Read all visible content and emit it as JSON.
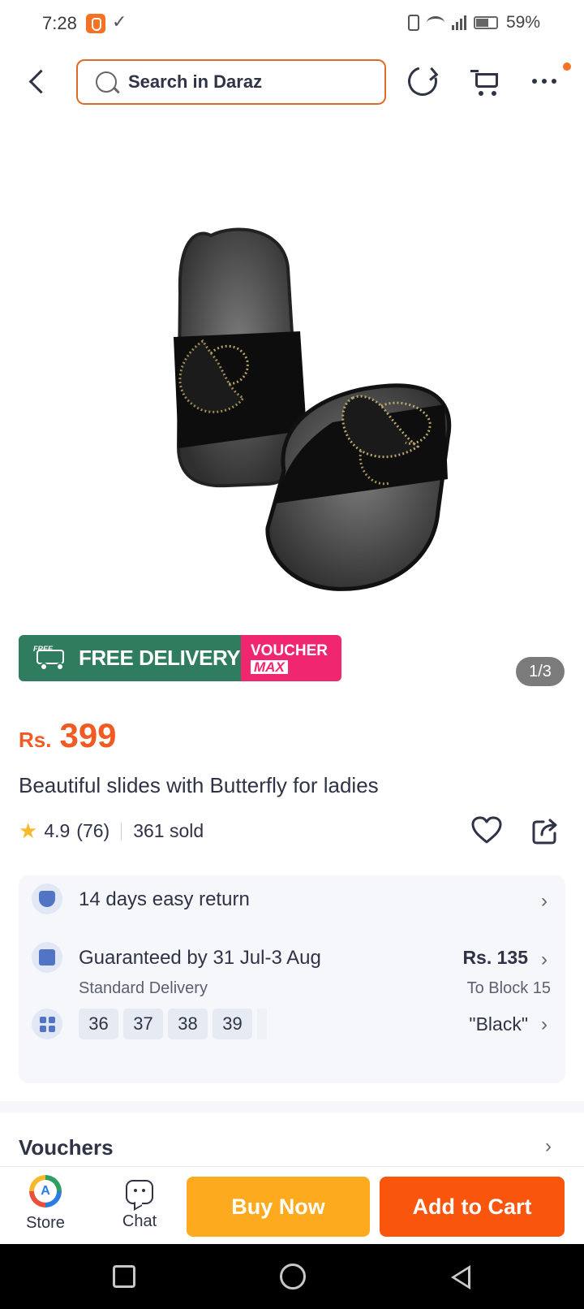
{
  "status_bar": {
    "time": "7:28",
    "battery": "59%"
  },
  "header": {
    "search_placeholder": "Search in Daraz"
  },
  "promo": {
    "free_tag": "FREE",
    "free_delivery": "FREE DELIVERY",
    "voucher_line1": "VOUCHER",
    "voucher_line2": "MAX"
  },
  "gallery": {
    "counter": "1/3"
  },
  "product": {
    "currency": "Rs.",
    "price": "399",
    "title": "Beautiful slides with Butterfly for ladies",
    "rating": "4.9",
    "reviews": "(76)",
    "sold": "361 sold"
  },
  "info": {
    "returns": "14 days easy return",
    "delivery_title": "Guaranteed by 31 Jul-3 Aug",
    "delivery_type": "Standard Delivery",
    "delivery_price": "Rs. 135",
    "delivery_to": "To Block 15",
    "sizes": [
      "36",
      "37",
      "38",
      "39"
    ],
    "color": "\"Black\""
  },
  "vouchers": {
    "title": "Vouchers"
  },
  "bottom_bar": {
    "store_label": "Store",
    "chat_label": "Chat",
    "buy_now": "Buy Now",
    "add_to_cart": "Add to Cart"
  },
  "colors": {
    "accent": "#f57224",
    "price": "#f15a22",
    "buy_now": "#fdaa1f",
    "add_to_cart": "#f9550d",
    "free_delivery": "#2f7d5e",
    "voucher": "#f0266f"
  }
}
